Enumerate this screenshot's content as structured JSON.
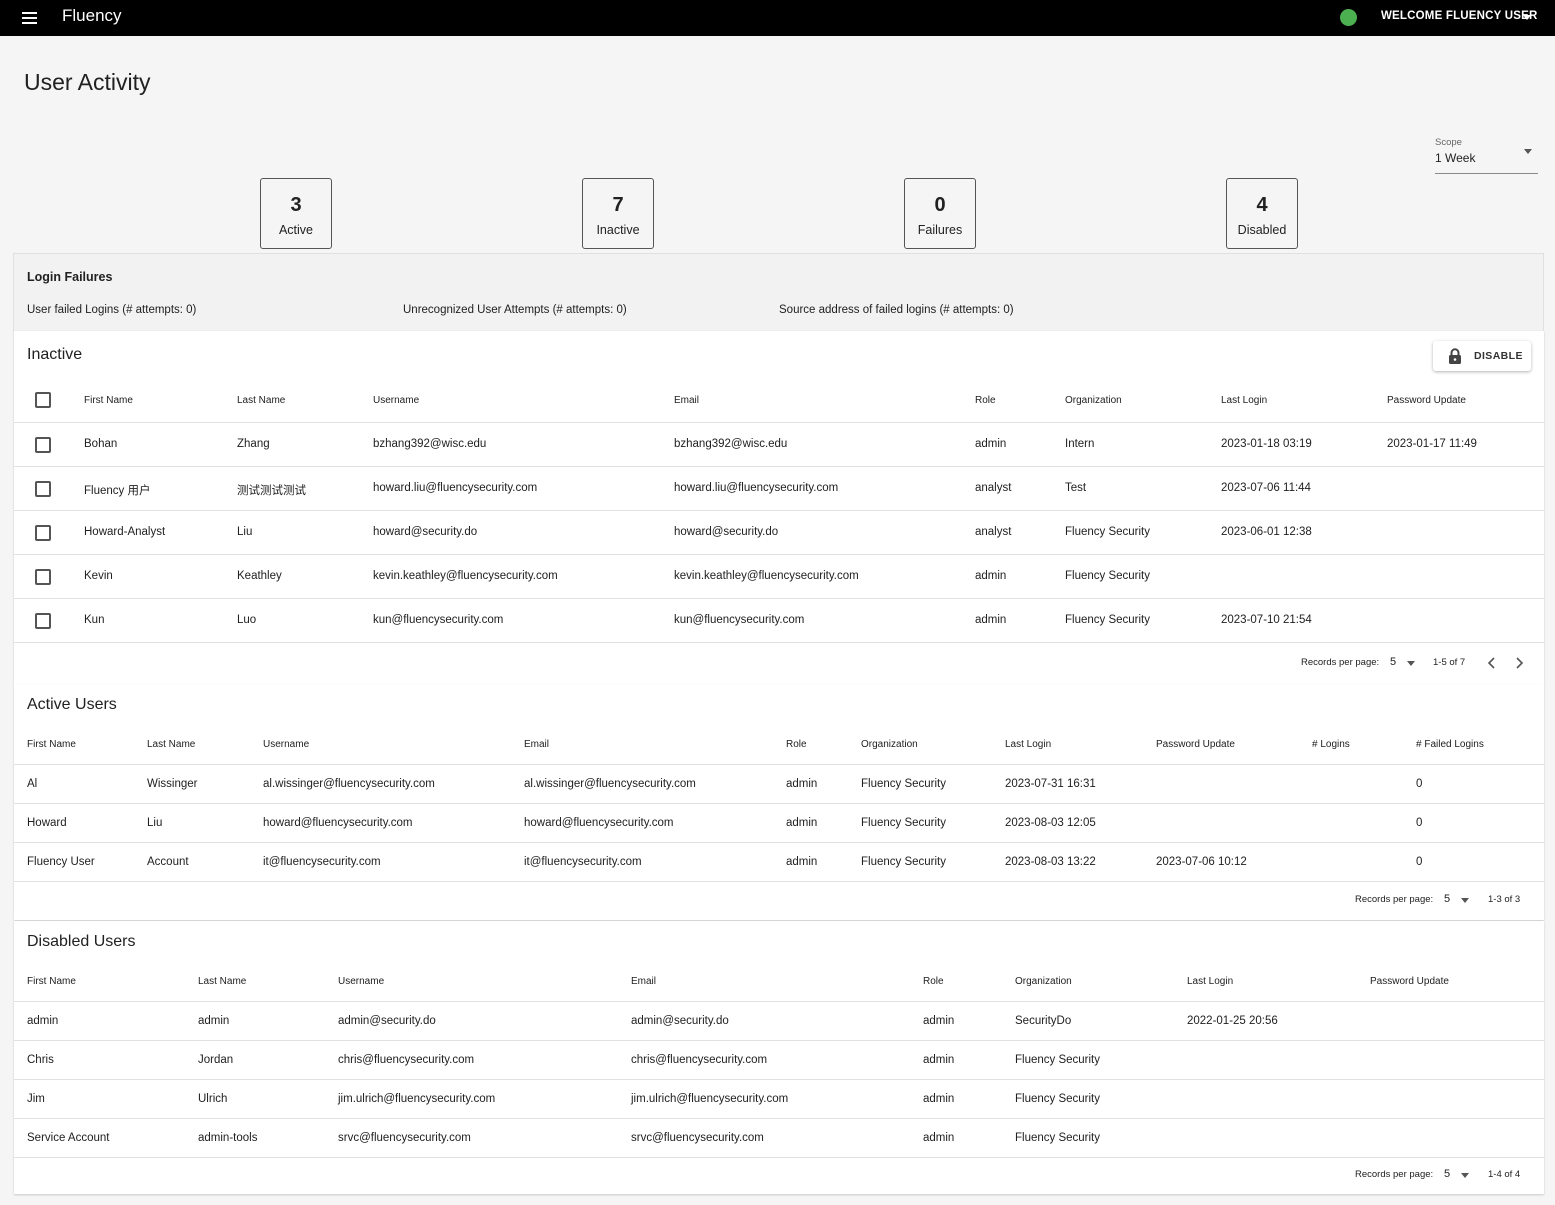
{
  "topbar": {
    "app_title": "Fluency",
    "welcome": "WELCOME FLUENCY USER",
    "status_color": "#4caf50",
    "menu_icon": "hamburger-menu-icon"
  },
  "page": {
    "title": "User Activity"
  },
  "scope": {
    "label": "Scope",
    "value": "1 Week"
  },
  "stats": [
    {
      "value": "3",
      "label": "Active"
    },
    {
      "value": "7",
      "label": "Inactive"
    },
    {
      "value": "0",
      "label": "Failures"
    },
    {
      "value": "4",
      "label": "Disabled"
    }
  ],
  "login_failures": {
    "title": "Login Failures",
    "items": [
      "User failed Logins (# attempts: 0)",
      "Unrecognized User Attempts (# attempts: 0)",
      "Source address of failed logins (# attempts: 0)"
    ]
  },
  "inactive": {
    "title": "Inactive",
    "disable_label": "DISABLE",
    "disable_icon": "lock-icon",
    "columns": [
      "First Name",
      "Last Name",
      "Username",
      "Email",
      "Role",
      "Organization",
      "Last Login",
      "Password Update"
    ],
    "rows": [
      [
        "Bohan",
        "Zhang",
        "bzhang392@wisc.edu",
        "bzhang392@wisc.edu",
        "admin",
        "Intern",
        "2023-01-18 03:19",
        "2023-01-17 11:49"
      ],
      [
        "Fluency 用户",
        "测试测试测试",
        "howard.liu@fluencysecurity.com",
        "howard.liu@fluencysecurity.com",
        "analyst",
        "Test",
        "2023-07-06 11:44",
        ""
      ],
      [
        "Howard-Analyst",
        "Liu",
        "howard@security.do",
        "howard@security.do",
        "analyst",
        "Fluency Security",
        "2023-06-01 12:38",
        ""
      ],
      [
        "Kevin",
        "Keathley",
        "kevin.keathley@fluencysecurity.com",
        "kevin.keathley@fluencysecurity.com",
        "admin",
        "Fluency Security",
        "",
        ""
      ],
      [
        "Kun",
        "Luo",
        "kun@fluencysecurity.com",
        "kun@fluencysecurity.com",
        "admin",
        "Fluency Security",
        "2023-07-10 21:54",
        ""
      ]
    ],
    "pager": {
      "label": "Records per page:",
      "value": "5",
      "range": "1-5 of 7"
    }
  },
  "active": {
    "title": "Active Users",
    "columns": [
      "First Name",
      "Last Name",
      "Username",
      "Email",
      "Role",
      "Organization",
      "Last Login",
      "Password Update",
      "# Logins",
      "# Failed Logins"
    ],
    "rows": [
      [
        "Al",
        "Wissinger",
        "al.wissinger@fluencysecurity.com",
        "al.wissinger@fluencysecurity.com",
        "admin",
        "Fluency Security",
        "2023-07-31 16:31",
        "",
        "",
        "0"
      ],
      [
        "Howard",
        "Liu",
        "howard@fluencysecurity.com",
        "howard@fluencysecurity.com",
        "admin",
        "Fluency Security",
        "2023-08-03 12:05",
        "",
        "",
        "0"
      ],
      [
        "Fluency User",
        "Account",
        "it@fluencysecurity.com",
        "it@fluencysecurity.com",
        "admin",
        "Fluency Security",
        "2023-08-03 13:22",
        "2023-07-06 10:12",
        "",
        "0"
      ]
    ],
    "pager": {
      "label": "Records per page:",
      "value": "5",
      "range": "1-3 of 3"
    }
  },
  "disabled": {
    "title": "Disabled Users",
    "columns": [
      "First Name",
      "Last Name",
      "Username",
      "Email",
      "Role",
      "Organization",
      "Last Login",
      "Password Update"
    ],
    "rows": [
      [
        "admin",
        "admin",
        "admin@security.do",
        "admin@security.do",
        "admin",
        "SecurityDo",
        "2022-01-25 20:56",
        ""
      ],
      [
        "Chris",
        "Jordan",
        "chris@fluencysecurity.com",
        "chris@fluencysecurity.com",
        "admin",
        "Fluency Security",
        "",
        ""
      ],
      [
        "Jim",
        "Ulrich",
        "jim.ulrich@fluencysecurity.com",
        "jim.ulrich@fluencysecurity.com",
        "admin",
        "Fluency Security",
        "",
        ""
      ],
      [
        "Service Account",
        "admin-tools",
        "srvc@fluencysecurity.com",
        "srvc@fluencysecurity.com",
        "admin",
        "Fluency Security",
        "",
        ""
      ]
    ],
    "pager": {
      "label": "Records per page:",
      "value": "5",
      "range": "1-4 of 4"
    }
  }
}
